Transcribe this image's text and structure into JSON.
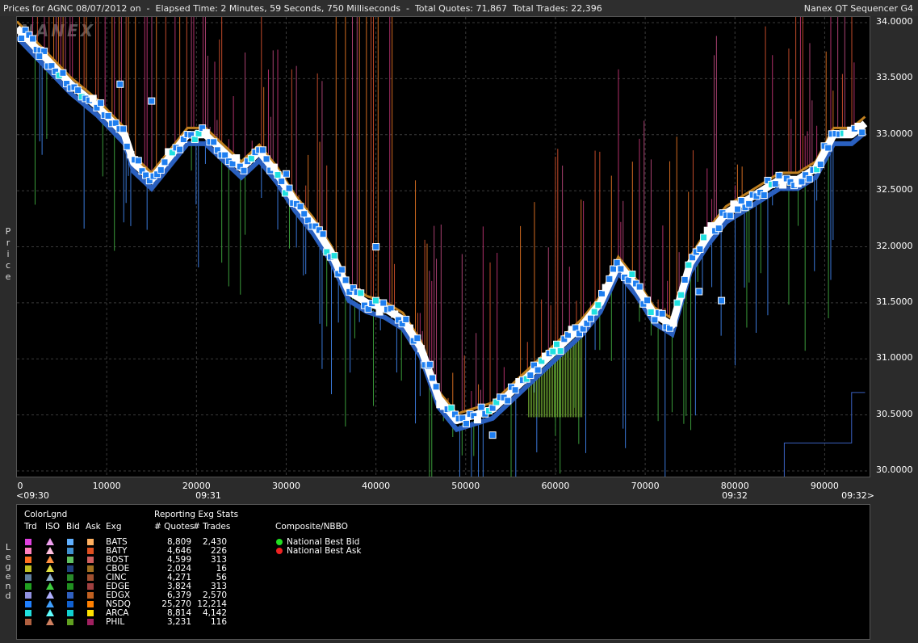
{
  "header": {
    "title": "Prices for AGNC 08/07/2012 on  -  Elapsed Time: 2 Minutes, 59 Seconds, 750 Milliseconds  -  Total Quotes: 71,867  Total Trades: 22,396",
    "app": "Nanex QT Sequencer G4"
  },
  "watermark": "NANEX",
  "y_axis_label": "Price",
  "legend_side_label": "Legend",
  "chart_data": {
    "type": "line",
    "x_range": [
      0,
      95000
    ],
    "y_range": [
      29.95,
      34.05
    ],
    "y_ticks": [
      "34.0000",
      "33.5000",
      "33.0000",
      "32.5000",
      "32.0000",
      "31.5000",
      "31.0000",
      "30.5000",
      "30.0000"
    ],
    "x_ticks": [
      "0",
      "10000",
      "20000",
      "30000",
      "40000",
      "50000",
      "60000",
      "70000",
      "80000",
      "90000"
    ],
    "x_time_labels": [
      "<09:30",
      "09:31",
      "09:32",
      "09:32>"
    ],
    "series": [
      {
        "role": "price",
        "x": [
          0,
          3000,
          6000,
          9000,
          12000,
          13000,
          15000,
          17000,
          19000,
          21000,
          23000,
          25000,
          27000,
          29000,
          31000,
          33000,
          35000,
          37000,
          39000,
          41000,
          43000,
          45000,
          47000,
          49000,
          51000,
          53000,
          55000,
          57000,
          59000,
          61000,
          63000,
          65000,
          67000,
          69000,
          71000,
          73000,
          75000,
          77000,
          79000,
          81000,
          83000,
          85000,
          87000,
          89000,
          91000,
          93000,
          94500
        ],
        "y": [
          33.95,
          33.7,
          33.45,
          33.25,
          33.0,
          32.75,
          32.6,
          32.8,
          33.0,
          33.0,
          32.85,
          32.7,
          32.85,
          32.65,
          32.4,
          32.2,
          31.95,
          31.6,
          31.5,
          31.45,
          31.35,
          31.1,
          30.65,
          30.45,
          30.5,
          30.55,
          30.7,
          30.85,
          31.0,
          31.15,
          31.3,
          31.5,
          31.85,
          31.65,
          31.4,
          31.3,
          31.85,
          32.1,
          32.3,
          32.4,
          32.5,
          32.6,
          32.6,
          32.7,
          33.0,
          33.0,
          33.1
        ]
      }
    ],
    "bid_color": "#3a78d8",
    "ask_color": "#c83a78"
  },
  "legend": {
    "color_legend": "ColorLgnd",
    "cols": [
      "Trd",
      "ISO",
      "Bid",
      "Ask",
      "Exg"
    ],
    "stats_title": "Reporting Exg Stats",
    "stats_cols": [
      "# Quotes",
      "# Trades"
    ],
    "composite_title": "Composite/NBBO",
    "nbbo": [
      {
        "label": "National Best Bid",
        "color": "#22dd22"
      },
      {
        "label": "National Best Ask",
        "color": "#ee2222"
      }
    ],
    "rows": [
      {
        "exg": "BATS",
        "quotes": "8,809",
        "trades": "2,430",
        "trd": "#e040e0",
        "iso": "#f0a0f0",
        "bid": "#60b0ff",
        "ask": "#ffb060"
      },
      {
        "exg": "BATY",
        "quotes": "4,646",
        "trades": "226",
        "trd": "#ff80c0",
        "iso": "#ffc0e0",
        "bid": "#4090d0",
        "ask": "#e05020"
      },
      {
        "exg": "BOST",
        "quotes": "4,599",
        "trades": "313",
        "trd": "#ff7020",
        "iso": "#ff9040",
        "bid": "#60c060",
        "ask": "#d06060"
      },
      {
        "exg": "CBOE",
        "quotes": "2,024",
        "trades": "16",
        "trd": "#c0c020",
        "iso": "#e0e040",
        "bid": "#204080",
        "ask": "#a07020"
      },
      {
        "exg": "CINC",
        "quotes": "4,271",
        "trades": "56",
        "trd": "#6080a0",
        "iso": "#90b0d0",
        "bid": "#2a8a2a",
        "ask": "#a05030"
      },
      {
        "exg": "EDGE",
        "quotes": "3,824",
        "trades": "313",
        "trd": "#20a020",
        "iso": "#40d040",
        "bid": "#209020",
        "ask": "#a04040"
      },
      {
        "exg": "EDGX",
        "quotes": "6,379",
        "trades": "2,570",
        "trd": "#9090e0",
        "iso": "#b0b0ff",
        "bid": "#3060c0",
        "ask": "#c06020"
      },
      {
        "exg": "NSDQ",
        "quotes": "25,270",
        "trades": "12,214",
        "trd": "#2080ff",
        "iso": "#40a0ff",
        "bid": "#1060d0",
        "ask": "#ff8000"
      },
      {
        "exg": "ARCA",
        "quotes": "8,814",
        "trades": "4,142",
        "trd": "#20e0e0",
        "iso": "#60ffff",
        "bid": "#10d0d0",
        "ask": "#ffe000"
      },
      {
        "exg": "PHIL",
        "quotes": "3,231",
        "trades": "116",
        "trd": "#b06040",
        "iso": "#d08060",
        "bid": "#60a020",
        "ask": "#a02060"
      }
    ]
  }
}
